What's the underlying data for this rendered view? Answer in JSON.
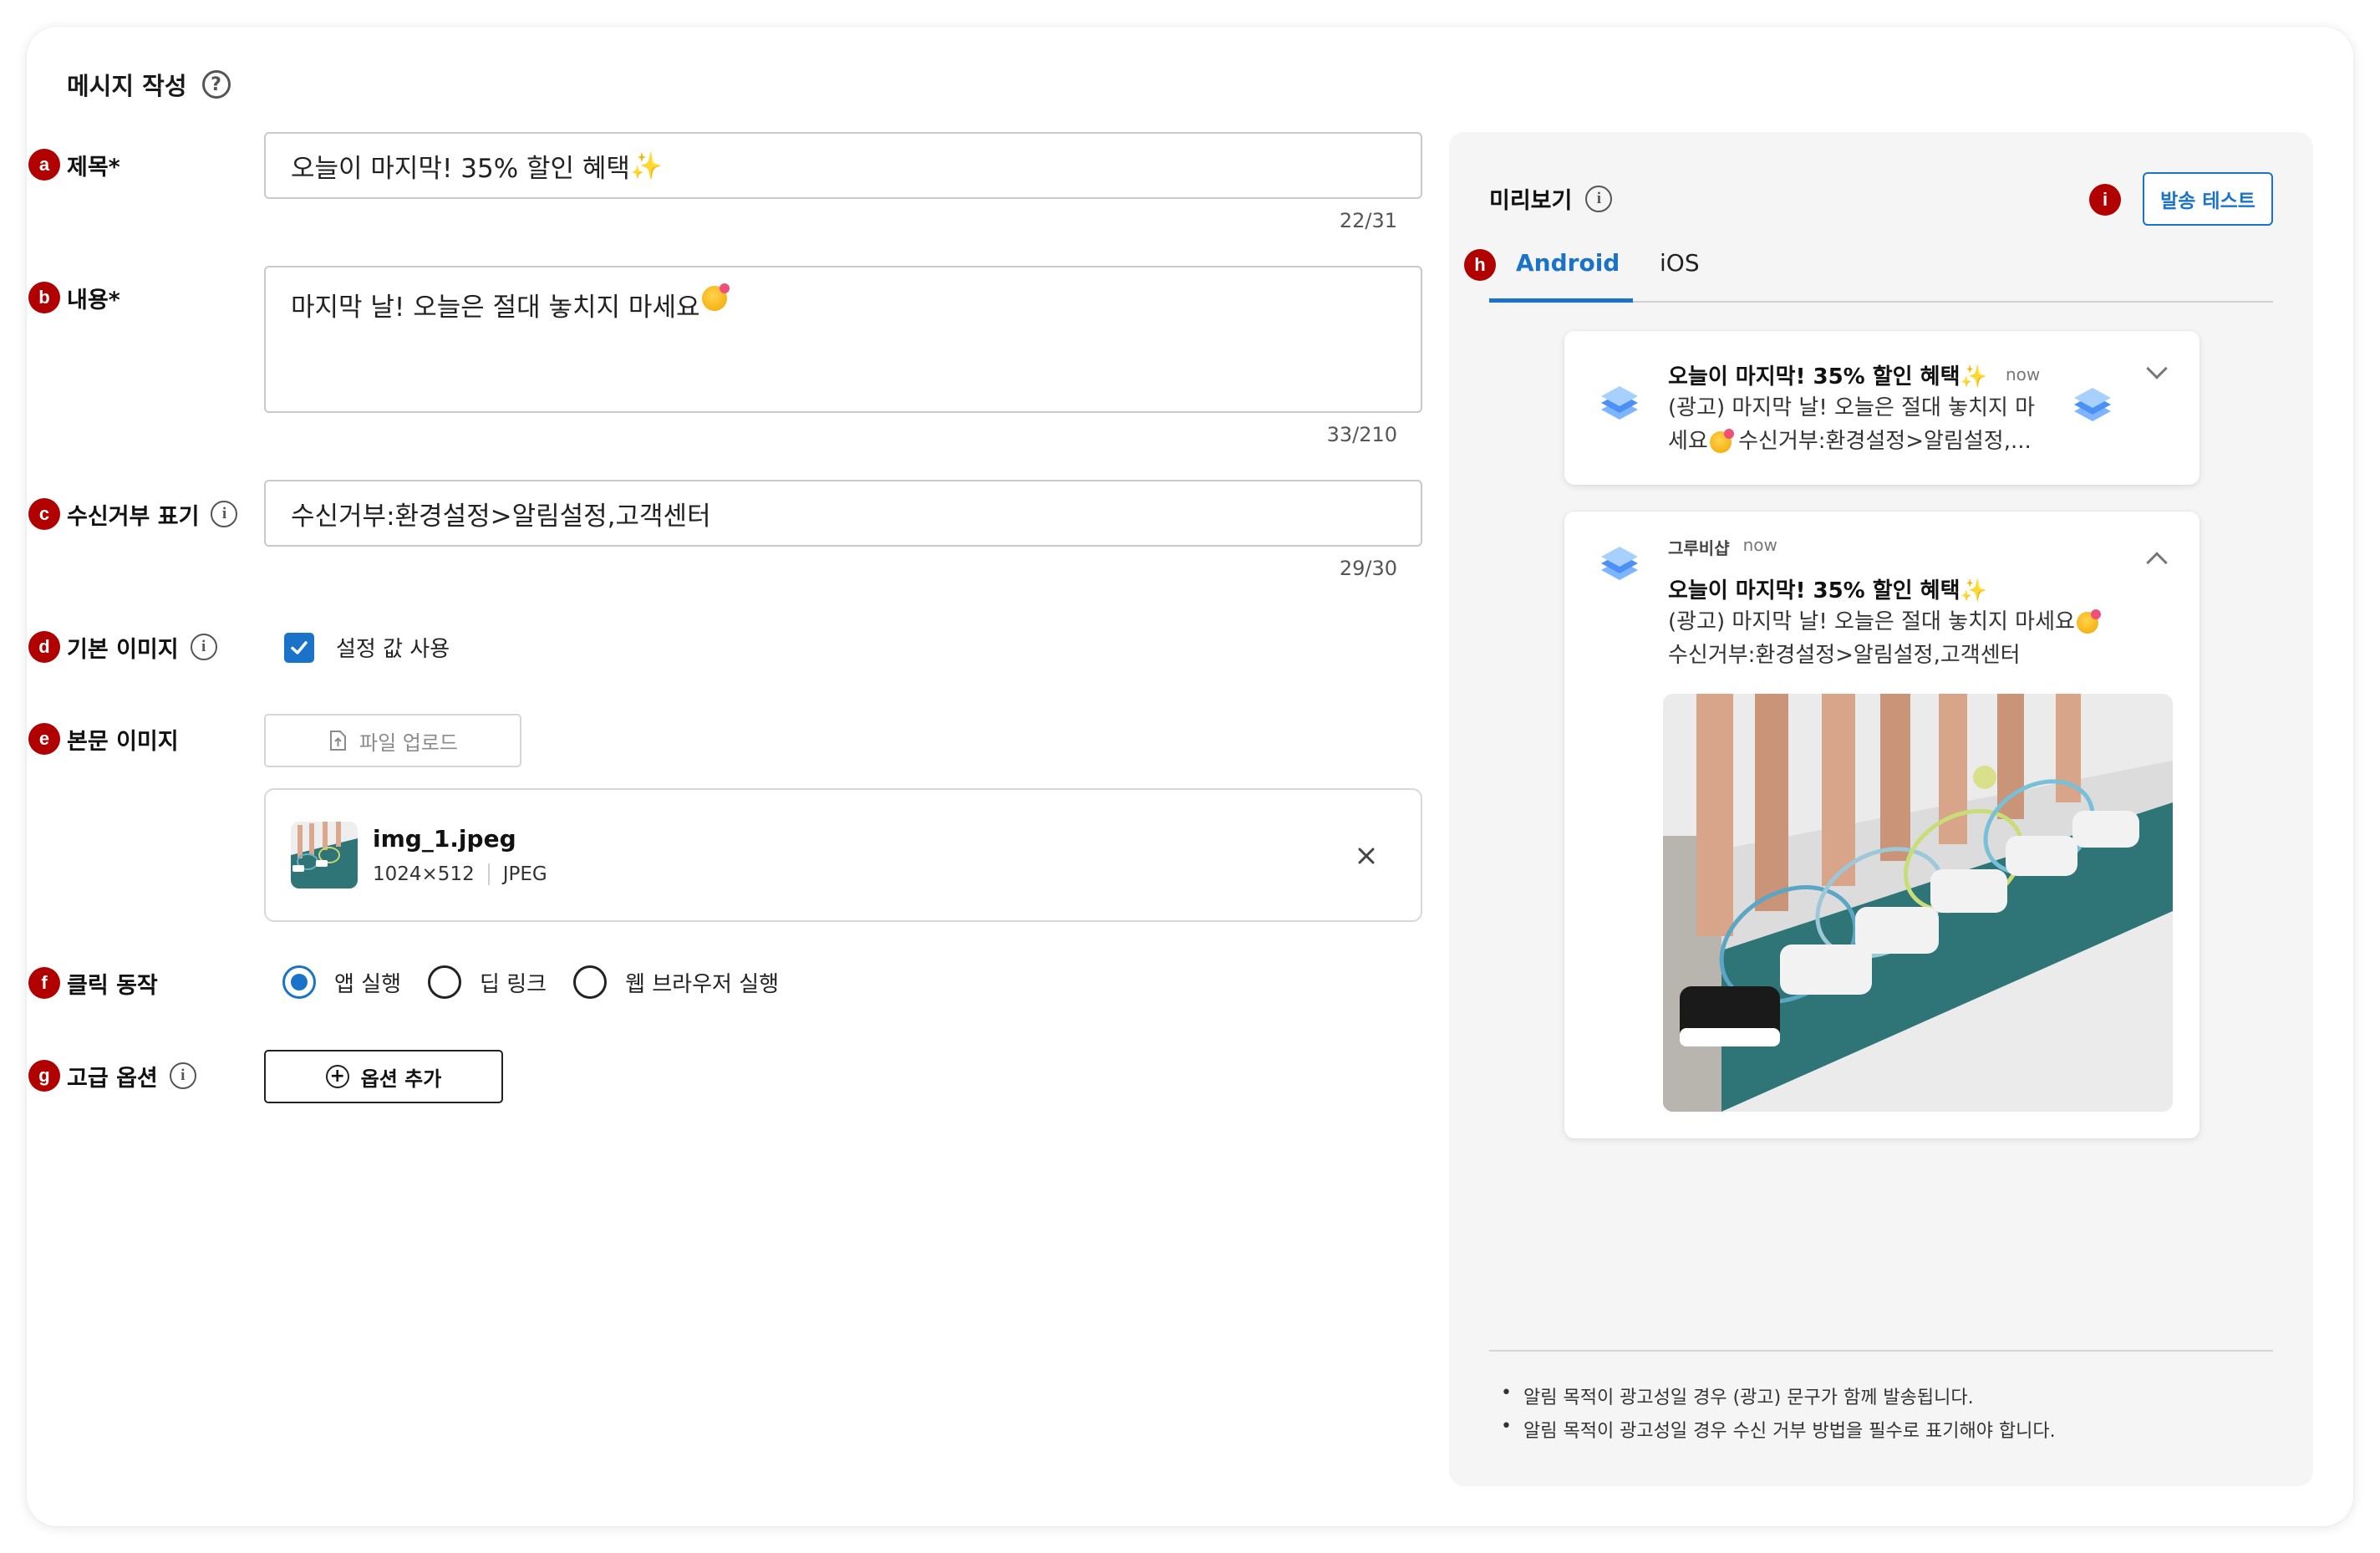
{
  "page": {
    "section_title": "메시지 작성"
  },
  "markers": [
    "a",
    "b",
    "c",
    "d",
    "e",
    "f",
    "g",
    "h",
    "i"
  ],
  "form": {
    "title": {
      "label": "제목*",
      "value": "오늘이 마지막! 35% 할인 혜택",
      "emoji": "✨",
      "counter": "22/31"
    },
    "content": {
      "label": "내용*",
      "value": "마지막 날! 오늘은 절대 놓치지 마세요",
      "emoji": "🥳",
      "counter": "33/210"
    },
    "opt_out": {
      "label": "수신거부 표기",
      "value": "수신거부:환경설정>알림설정,고객센터",
      "counter": "29/30"
    },
    "default_image": {
      "label": "기본 이미지",
      "checkbox_label": "설정 값 사용",
      "checked": true
    },
    "body_image": {
      "label": "본문 이미지",
      "upload_label": "파일 업로드",
      "file": {
        "name": "img_1.jpeg",
        "dimensions": "1024×512",
        "type": "JPEG"
      }
    },
    "click_action": {
      "label": "클릭 동작",
      "options": [
        "앱 실행",
        "딥 링크",
        "웹 브라우저 실행"
      ],
      "selected": "앱 실행"
    },
    "advanced": {
      "label": "고급 옵션",
      "button_label": "옵션 추가"
    }
  },
  "preview": {
    "title": "미리보기",
    "test_button": "발송 테스트",
    "tabs": [
      "Android",
      "iOS"
    ],
    "active_tab": "Android",
    "collapsed": {
      "title": "오늘이 마지막! 35% 할인 혜택",
      "emoji": "✨",
      "time": "now",
      "body_line1": "(광고) 마지막 날! 오늘은 절대 놓치지 마",
      "body_line2_a": "세요",
      "body_line2_emoji": "🥳",
      "body_line2_b": " 수신거부:환경설정>알림설정,..."
    },
    "expanded": {
      "app_name": "그루비샵",
      "time": "now",
      "title": "오늘이 마지막! 35% 할인 혜택",
      "emoji": "✨",
      "body_line1": "(광고) 마지막 날! 오늘은 절대 놓치지 마세요",
      "body_line1_emoji": "🥳",
      "body_line2": "수신거부:환경설정>알림설정,고객센터"
    },
    "notes": [
      "알림 목적이 광고성일 경우 (광고) 문구가 함께 발송됩니다.",
      "알림 목적이 광고성일 경우 수신 거부 방법을 필수로 표기해야 합니다."
    ]
  },
  "colors": {
    "accent": "#1a73c9",
    "marker": "#b10000",
    "panel_bg": "#f5f5f5",
    "court": "#2f7578"
  }
}
